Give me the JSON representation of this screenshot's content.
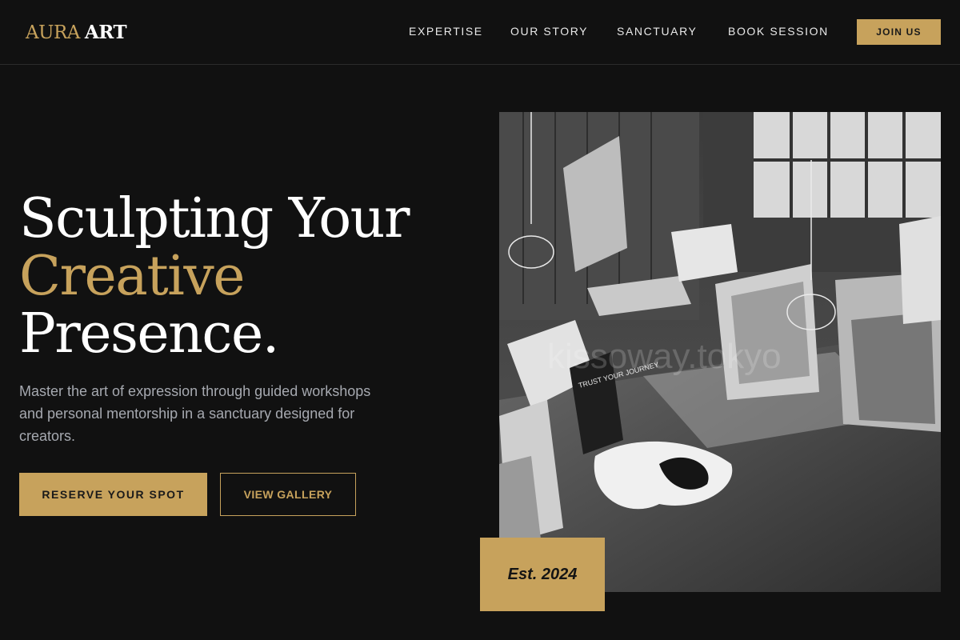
{
  "header": {
    "logo": {
      "part1": "AURA",
      "part2": "ART"
    },
    "nav": [
      {
        "label": "EXPERTISE"
      },
      {
        "label": "OUR STORY"
      },
      {
        "label": "SANCTUARY"
      },
      {
        "label": "BOOK SESSION"
      }
    ],
    "cta_label": "JOIN US"
  },
  "hero": {
    "headline": {
      "line1": "Sculpting Your",
      "line2": "Creative",
      "line3": "Presence."
    },
    "subtext": "Master the art of expression through guided workshops and personal mentorship in a sanctuary designed for creators.",
    "primary_button": "RESERVE YOUR SPOT",
    "secondary_button": "VIEW GALLERY",
    "badge": "Est. 2024",
    "image_sign_text": "TRUST YOUR JOURNEY",
    "image_watermark": "kissoway.tokyo"
  },
  "colors": {
    "background": "#111111",
    "accent_gold": "#c7a25c",
    "text_primary": "#ffffff",
    "text_muted": "#a6a9b0"
  }
}
